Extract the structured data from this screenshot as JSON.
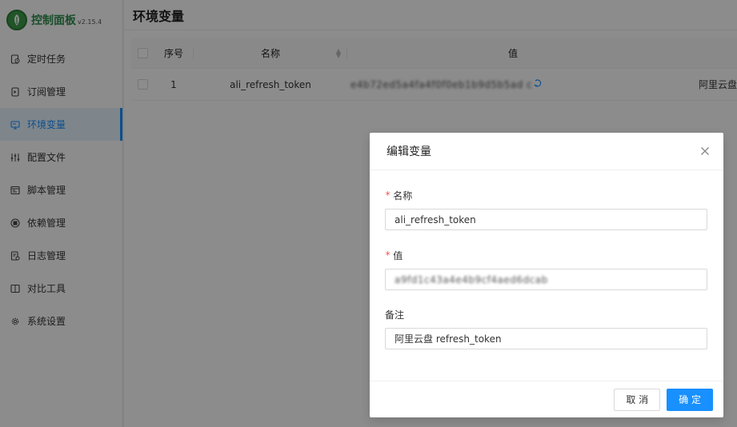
{
  "app": {
    "title": "控制面板",
    "version": "v2.15.4"
  },
  "sidebar": {
    "items": [
      {
        "label": "定时任务",
        "icon": "clock-file-icon",
        "active": false
      },
      {
        "label": "订阅管理",
        "icon": "subscription-icon",
        "active": false
      },
      {
        "label": "环境变量",
        "icon": "monitor-icon",
        "active": true
      },
      {
        "label": "配置文件",
        "icon": "sliders-icon",
        "active": false
      },
      {
        "label": "脚本管理",
        "icon": "script-icon",
        "active": false
      },
      {
        "label": "依赖管理",
        "icon": "package-icon",
        "active": false
      },
      {
        "label": "日志管理",
        "icon": "log-icon",
        "active": false
      },
      {
        "label": "对比工具",
        "icon": "diff-icon",
        "active": false
      },
      {
        "label": "系统设置",
        "icon": "gear-icon",
        "active": false
      }
    ]
  },
  "page": {
    "title": "环境变量"
  },
  "table": {
    "headers": {
      "index": "序号",
      "name": "名称",
      "value": "值"
    },
    "rows": [
      {
        "index": "1",
        "name": "ali_refresh_token",
        "value": "e4b72ed5a4fa4f0f0eb1b9d5b5ad c",
        "remark": "阿里云盘"
      }
    ]
  },
  "modal": {
    "title": "编辑变量",
    "fields": {
      "name_label": "名称",
      "name_value": "ali_refresh_token",
      "value_label": "值",
      "value_value": "a9fd1c43a4e4b9cf4aed6dcab",
      "remark_label": "备注",
      "remark_value": "阿里云盘 refresh_token"
    },
    "cancel_label": "取 消",
    "ok_label": "确 定"
  },
  "colors": {
    "primary": "#1890ff",
    "brand_green": "#2f8f4e",
    "required": "#ff4d4f"
  }
}
